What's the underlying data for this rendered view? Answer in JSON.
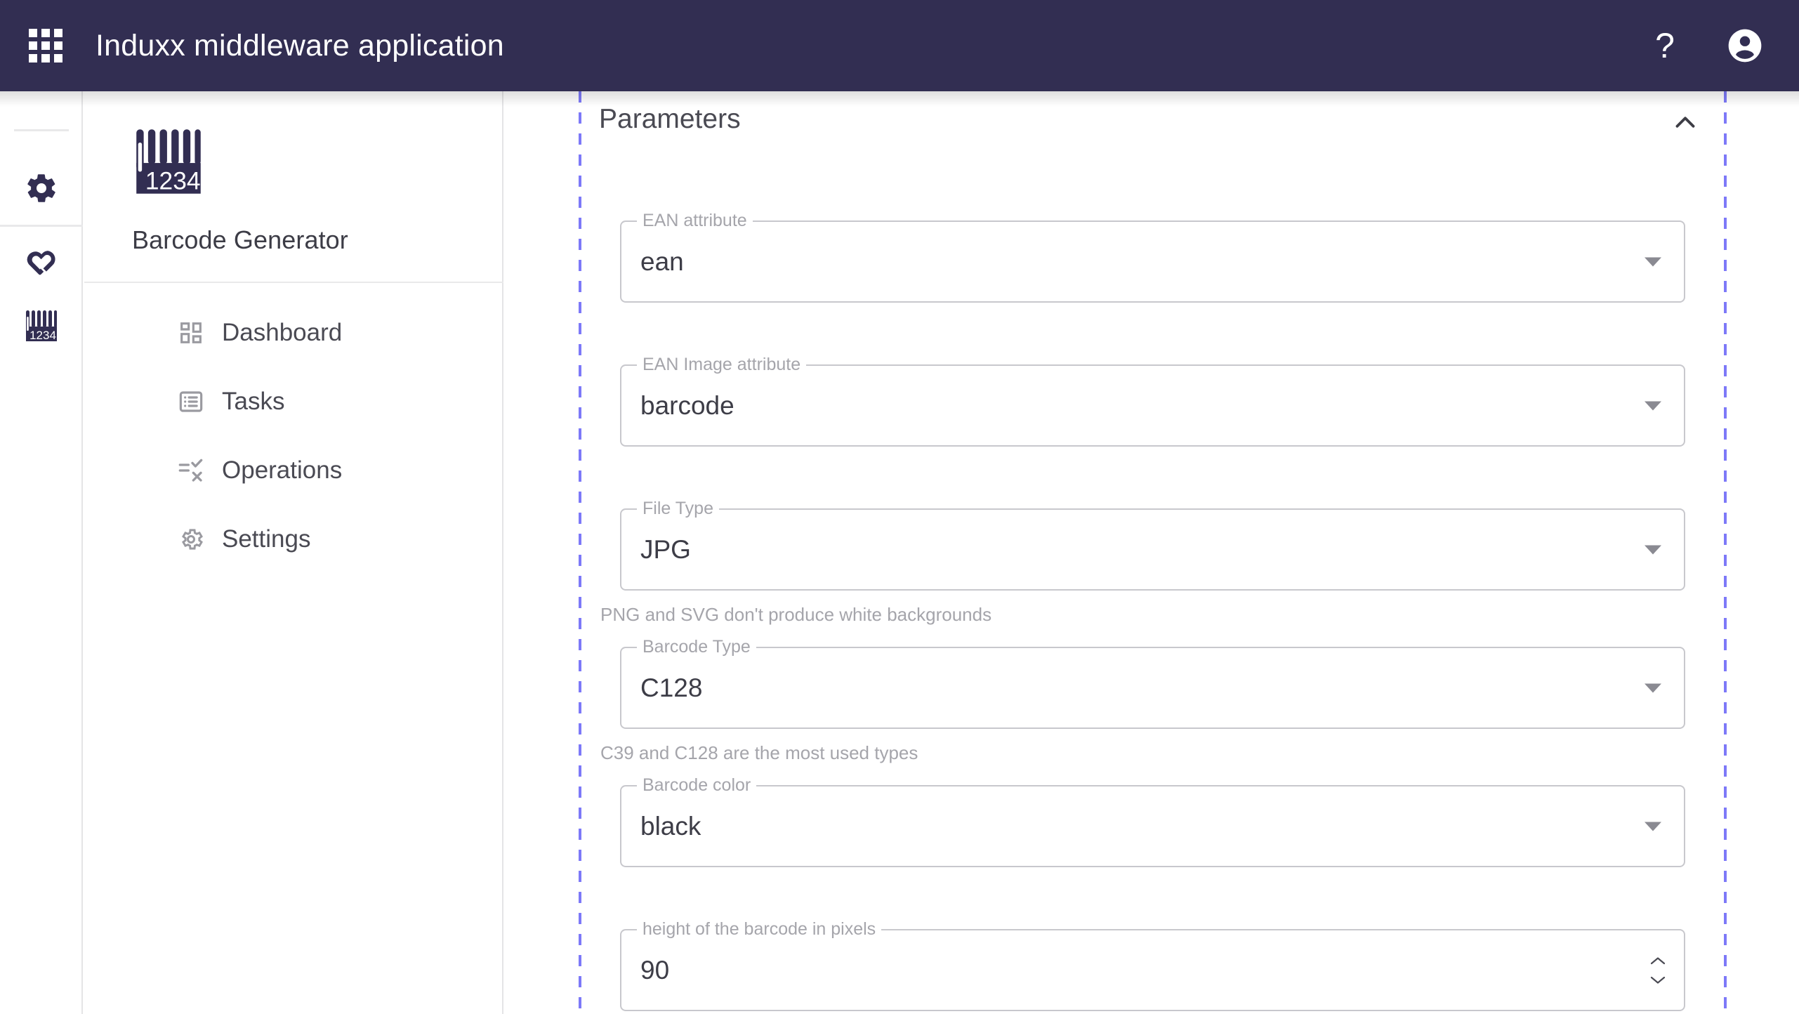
{
  "header": {
    "app_grid_icon": "apps-grid-icon",
    "title": "Induxx middleware application",
    "help_icon": "help-question-icon",
    "help_label": "?",
    "account_icon": "account-circle-icon"
  },
  "rail": {
    "items": [
      {
        "icon": "gear-icon",
        "name": "settings"
      },
      {
        "icon": "heart-link-logo-icon",
        "name": "induxx-logo"
      },
      {
        "icon": "barcode-1234-icon",
        "name": "barcode-generator"
      }
    ]
  },
  "sidebar": {
    "logo_icon": "barcode-1234-logo",
    "logo_digits": "1234",
    "app_name": "Barcode Generator",
    "items": [
      {
        "label": "Dashboard",
        "icon": "dashboard-grid-icon"
      },
      {
        "label": "Tasks",
        "icon": "list-alt-icon"
      },
      {
        "label": "Operations",
        "icon": "rule-checklist-icon"
      },
      {
        "label": "Settings",
        "icon": "gear-outline-icon"
      }
    ]
  },
  "panel": {
    "title": "Parameters",
    "collapse_icon": "chevron-up-icon",
    "expanded": true
  },
  "form": {
    "fields": [
      {
        "label": "EAN attribute",
        "value": "ean",
        "control": "select",
        "helper": "",
        "name": "ean-attribute"
      },
      {
        "label": "EAN Image attribute",
        "value": "barcode",
        "control": "select",
        "helper": "",
        "name": "ean-image-attribute"
      },
      {
        "label": "File Type",
        "value": "JPG",
        "control": "select",
        "helper": "PNG and SVG don't produce white backgrounds",
        "name": "file-type"
      },
      {
        "label": "Barcode Type",
        "value": "C128",
        "control": "select",
        "helper": "C39 and C128 are the most used types",
        "name": "barcode-type"
      },
      {
        "label": "Barcode color",
        "value": "black",
        "control": "select",
        "helper": "",
        "name": "barcode-color"
      },
      {
        "label": "height of the barcode in pixels",
        "value": "90",
        "control": "number",
        "helper": "",
        "name": "barcode-height"
      }
    ]
  },
  "colors": {
    "header_bg": "#322e52",
    "brand_dark": "#322e52",
    "guide_dashed": "#7d79f8",
    "border": "#c8c8cd",
    "label_muted": "#a5a5ab",
    "text": "#3d3d47"
  }
}
